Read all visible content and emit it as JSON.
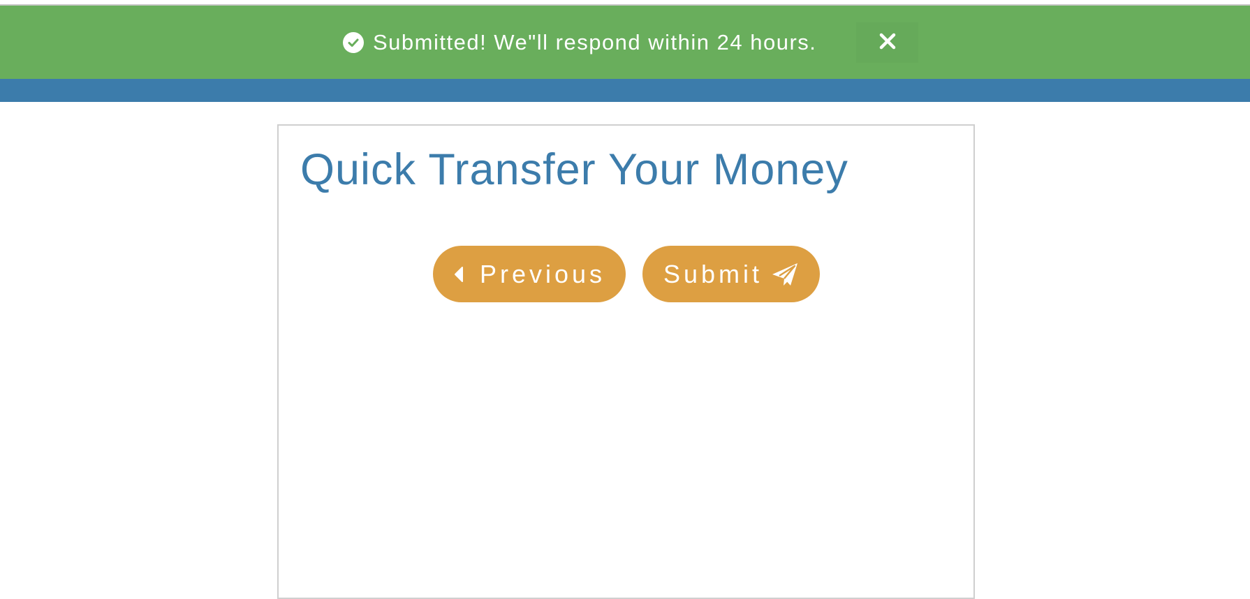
{
  "alert": {
    "message": "Submitted! We\"ll respond within 24 hours.",
    "status_icon": "check-circle-icon",
    "close_icon": "close-icon"
  },
  "panel": {
    "title": "Quick Transfer Your Money"
  },
  "actions": {
    "previous_label": "Previous",
    "previous_icon": "caret-left-icon",
    "submit_label": "Submit",
    "submit_icon": "paper-plane-icon"
  },
  "colors": {
    "success": "#69ae5c",
    "nav": "#3c7cab",
    "title": "#3c7cab",
    "button": "#dd9f42"
  }
}
